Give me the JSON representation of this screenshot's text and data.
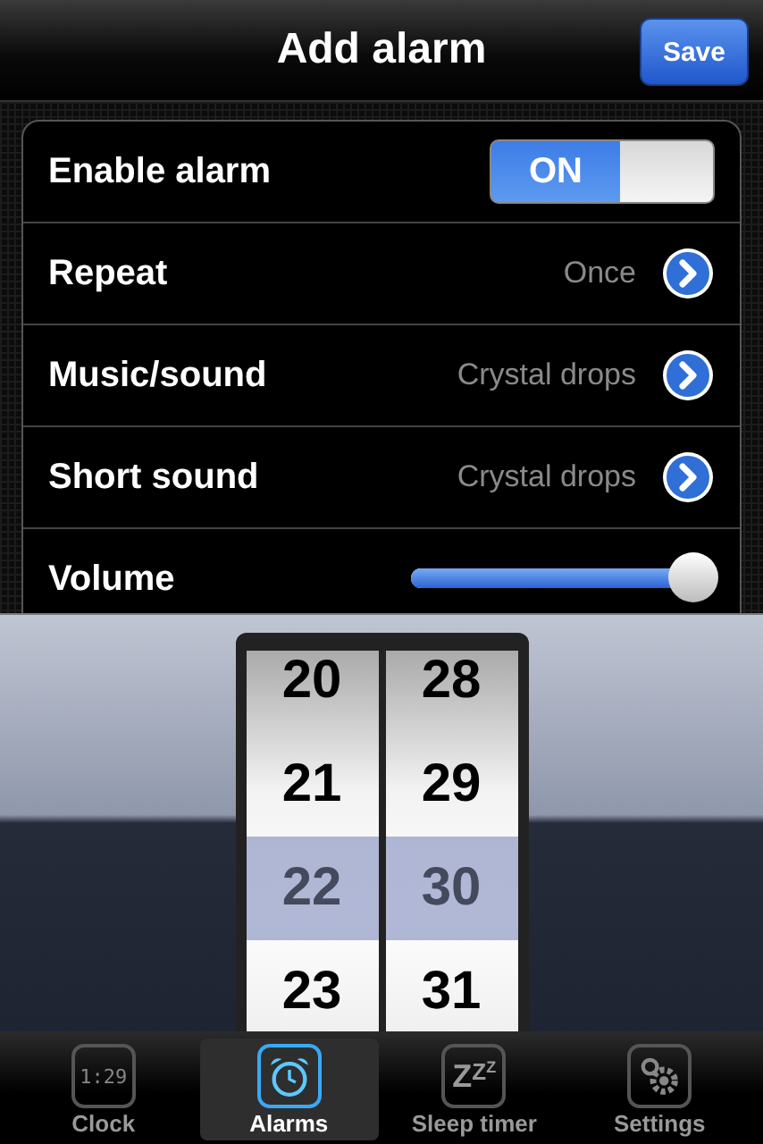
{
  "nav_bar": {
    "title": "Add alarm",
    "save_button": "Save"
  },
  "settings": [
    {
      "kind": "switch",
      "label": "Enable alarm",
      "on": true,
      "switch_text": "ON"
    },
    {
      "kind": "detail",
      "label": "Repeat",
      "value": "Once"
    },
    {
      "kind": "detail",
      "label": "Music/sound",
      "value": "Crystal drops"
    },
    {
      "kind": "detail",
      "label": "Short sound",
      "value": "Crystal drops"
    },
    {
      "kind": "slider",
      "label": "Volume",
      "level": 0.93
    }
  ],
  "picker": {
    "columns": [
      {
        "items": [
          {
            "label": "20",
            "selected": false
          },
          {
            "label": "21",
            "selected": false
          },
          {
            "label": "22",
            "selected": true
          },
          {
            "label": "23",
            "selected": false
          }
        ]
      },
      {
        "items": [
          {
            "label": "28",
            "selected": false
          },
          {
            "label": "29",
            "selected": false
          },
          {
            "label": "30",
            "selected": true
          },
          {
            "label": "31",
            "selected": false
          }
        ]
      }
    ]
  },
  "tab_bar": [
    {
      "kind": "clock",
      "label": "Clock",
      "icon_text": "1:29",
      "selected": false
    },
    {
      "kind": "alarm",
      "label": "Alarms",
      "selected": true
    },
    {
      "kind": "sleep",
      "label": "Sleep timer",
      "icon_text": "ZZZ",
      "selected": false
    },
    {
      "kind": "settings",
      "label": "Settings",
      "selected": false
    }
  ]
}
